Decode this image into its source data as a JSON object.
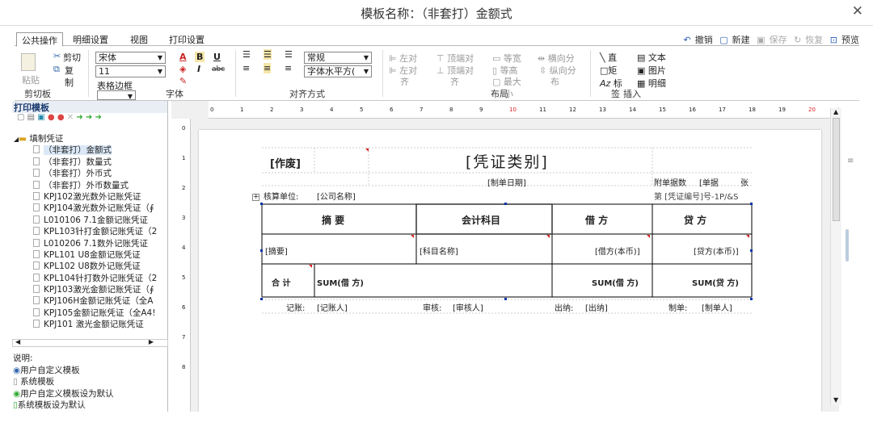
{
  "window": {
    "title": "模板名称：（非套打）金额式",
    "close": "✕"
  },
  "tabs": [
    "公共操作",
    "明细设置",
    "视图",
    "打印设置"
  ],
  "toolbar_right": {
    "undo": "撤销",
    "new": "新建",
    "save": "保存",
    "restore": "恢复",
    "preview": "预览"
  },
  "ribbon": {
    "clipboard": {
      "paste": "粘贴",
      "cut": "剪切",
      "copy": "复",
      "copy2": "制",
      "label": "剪切板"
    },
    "font": {
      "family": "宋体",
      "size": "11",
      "border_label": "表格边框",
      "label": "字体",
      "bold": "B",
      "italic": "I",
      "underline": "U",
      "strike": "abc",
      "color_a": "A"
    },
    "align": {
      "style": "常规",
      "direction": "字体水平方(",
      "label": "对齐方式"
    },
    "layout": {
      "left": "左对",
      "left2": "齐",
      "top": "顶端对",
      "top2": "齐",
      "eqw": "等宽",
      "eqh": "等高",
      "maxw": "最大",
      "hdist": "横向分",
      "vdist": "纵向分",
      "dist2": "布",
      "label": "布局",
      "small": "小"
    },
    "insert": {
      "line": "直",
      "rect": "矩",
      "label_sign": "标",
      "text": "文本",
      "image": "图片",
      "detail": "明细",
      "label": "插入",
      "sig": "签"
    }
  },
  "left_panel": {
    "header": "打印模板",
    "root": "填制凭证",
    "items": [
      "（非套打）金额式",
      "（非套打）数量式",
      "（非套打）外币式",
      "（非套打）外币数量式",
      "KPJ102激光数外记账凭证",
      "KPJ104激光数外记账凭证（∮",
      "L010106 7.1金额记账凭证",
      "KPL103针打金额记账凭证（2",
      "L010206 7.1数外记账凭证",
      "KPL101 U8金额记账凭证",
      "KPL102 U8数外记账凭证",
      "KPL104针打数外记账凭证（2",
      "KPJ103激光金额记账凭证（∮",
      "KPJ106H金额记账凭证（全A",
      "KPJ105金额记账凭证（全A4!",
      "KPJ101 激光金额记账凭证"
    ],
    "legend_title": "说明:",
    "legend": [
      "用户自定义模板",
      "系统模板",
      "用户自定义模板设为默认",
      "系统模板设为默认"
    ]
  },
  "ruler_top": [
    "0",
    "1",
    "2",
    "3",
    "4",
    "5",
    "6",
    "7",
    "8",
    "9",
    "10",
    "11",
    "12",
    "13",
    "14",
    "15",
    "16",
    "17",
    "18",
    "19",
    "20",
    "21"
  ],
  "ruler_left": [
    "0",
    "1",
    "2",
    "3",
    "4",
    "5",
    "6",
    "7",
    "8"
  ],
  "voucher": {
    "void": "[作废]",
    "type": "[凭证类别]",
    "date": "[制单日期]",
    "attach": "附单据数",
    "attach2": "[单据",
    "zhang": "张",
    "unit_label": "核算单位:",
    "unit": "[公司名称]",
    "voucher_no": "第 [凭证编号]号-1P/&S",
    "headers": [
      "摘  要",
      "会计科目",
      "借  方",
      "贷  方"
    ],
    "row": [
      "[摘要]",
      "[科目名称]",
      "[借方(本币)]",
      "[贷方(本币)]"
    ],
    "total_label": "合  计",
    "sum1": "SUM(借  方)",
    "sum2": "SUM(借  方)",
    "sum3": "SUM(贷  方)",
    "footer": [
      "记账:",
      "[记账人]",
      "审核:",
      "[审核人]",
      "出纳:",
      "[出纳]",
      "制单:",
      "[制单人]"
    ]
  }
}
